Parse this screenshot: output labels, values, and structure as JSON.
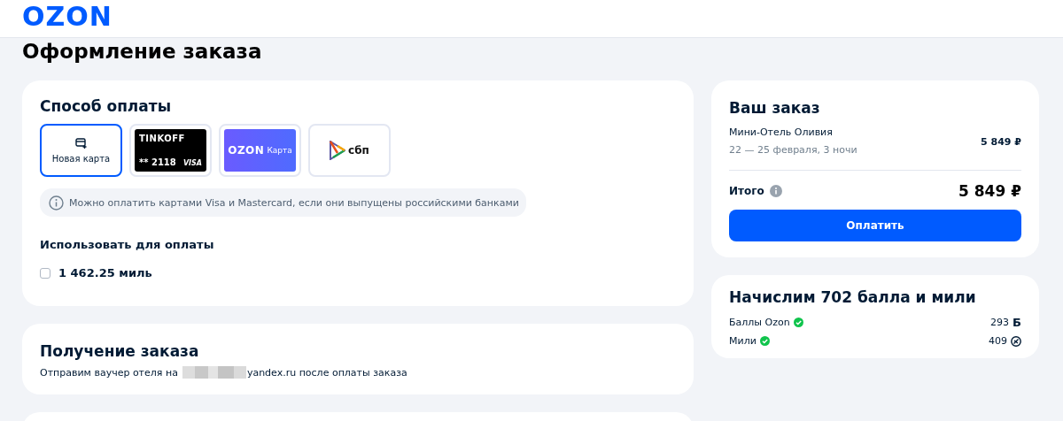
{
  "header": {
    "logo": "OZON"
  },
  "page_title": "Оформление заказа",
  "payment": {
    "title": "Способ оплаты",
    "methods": [
      {
        "kind": "new_card",
        "label": "Новая карта",
        "selected": true
      },
      {
        "kind": "bank_card",
        "bank": "TINKOFF",
        "number": "** 2118",
        "network": "VISA",
        "selected": false
      },
      {
        "kind": "ozon_card",
        "brand": "OZON",
        "label": "Карта",
        "selected": false
      },
      {
        "kind": "sbp",
        "label": "сбп",
        "selected": false
      }
    ],
    "notice": "Можно оплатить картами Visa и Mastercard, если они выпущены российскими банками",
    "use_title": "Использовать для оплаты",
    "miles_option": {
      "label": "1 462.25 миль",
      "checked": false
    }
  },
  "receiving": {
    "title": "Получение заказа",
    "text_before": "Отправим ваучер отеля на",
    "text_after": "yandex.ru после оплаты заказа"
  },
  "order": {
    "title": "Ваш заказ",
    "item": {
      "name": "Мини-Отель Оливия",
      "dates": "22 — 25 февраля, 3 ночи",
      "price": "5 849 ₽"
    },
    "total_label": "Итого",
    "total": "5 849 ₽",
    "pay_button": "Оплатить"
  },
  "bonus": {
    "title": "Начислим 702 балла и мили",
    "rows": [
      {
        "kind": "points",
        "label": "Баллы Ozon",
        "value": "293",
        "unit": "Б"
      },
      {
        "kind": "miles",
        "label": "Мили",
        "value": "409"
      }
    ]
  }
}
